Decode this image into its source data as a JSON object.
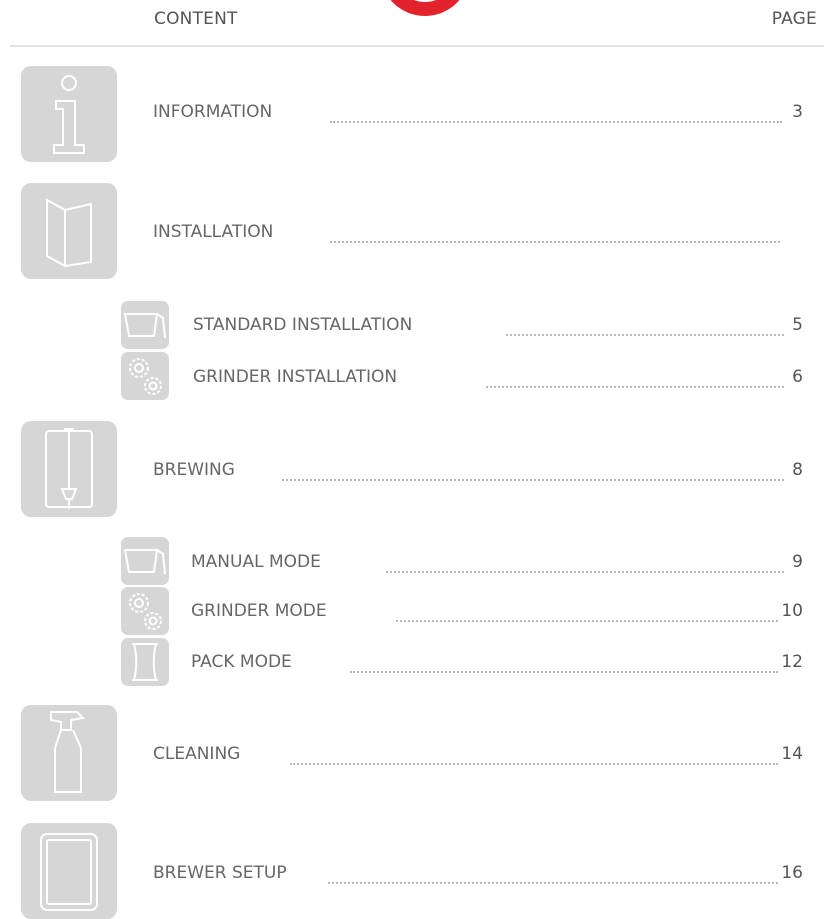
{
  "header": {
    "content_label": "CONTENT",
    "page_label": "PAGE"
  },
  "entries": [
    {
      "label": "INFORMATION",
      "page": "3",
      "icon": "info-icon"
    },
    {
      "label": "INSTALLATION",
      "page": "",
      "icon": "booklet-icon"
    },
    {
      "label": "STANDARD INSTALLATION",
      "page": "5",
      "icon": "basket-icon"
    },
    {
      "label": "GRINDER INSTALLATION",
      "page": "6",
      "icon": "gears-icon"
    },
    {
      "label": "BREWING",
      "page": "8",
      "icon": "brewer-icon"
    },
    {
      "label": "MANUAL MODE",
      "page": "9",
      "icon": "basket-icon"
    },
    {
      "label": "GRINDER MODE",
      "page": "10",
      "icon": "gears-icon"
    },
    {
      "label": "PACK MODE",
      "page": "12",
      "icon": "pack-icon"
    },
    {
      "label": "CLEANING",
      "page": "14",
      "icon": "spray-bottle-icon"
    },
    {
      "label": "BREWER SETUP",
      "page": "16",
      "icon": "display-icon"
    }
  ],
  "colors": {
    "accent": "#e2232b",
    "tile": "#d6d6d6",
    "dots": "#b8b8b8"
  }
}
